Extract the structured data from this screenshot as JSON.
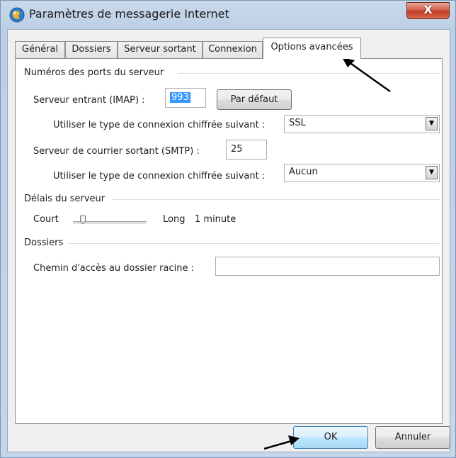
{
  "window": {
    "title": "Paramètres de messagerie Internet",
    "close_label": "X"
  },
  "tabs": [
    {
      "label": "Général",
      "active": false
    },
    {
      "label": "Dossiers",
      "active": false
    },
    {
      "label": "Serveur sortant",
      "active": false
    },
    {
      "label": "Connexion",
      "active": false
    },
    {
      "label": "Options avancées",
      "active": true
    }
  ],
  "ports": {
    "group_label": "Numéros des ports du serveur",
    "incoming_label": "Serveur entrant (IMAP) :",
    "incoming_value": "993",
    "default_button": "Par défaut",
    "incoming_enc_label": "Utiliser le type de connexion chiffrée suivant :",
    "incoming_enc_value": "SSL",
    "outgoing_label": "Serveur de courrier sortant (SMTP) :",
    "outgoing_value": "25",
    "outgoing_enc_label": "Utiliser le type de connexion chiffrée suivant :",
    "outgoing_enc_value": "Aucun"
  },
  "timeouts": {
    "group_label": "Délais du serveur",
    "short_label": "Court",
    "long_label": "Long",
    "value_label": "1 minute",
    "slider_level": 0.05
  },
  "folders": {
    "group_label": "Dossiers",
    "root_label": "Chemin d'accès au dossier racine :",
    "root_value": ""
  },
  "buttons": {
    "ok": "OK",
    "cancel": "Annuler"
  },
  "colors": {
    "selection": "#3399ff",
    "ok_border": "#3c7fb1",
    "close_red": "#c03a23"
  }
}
